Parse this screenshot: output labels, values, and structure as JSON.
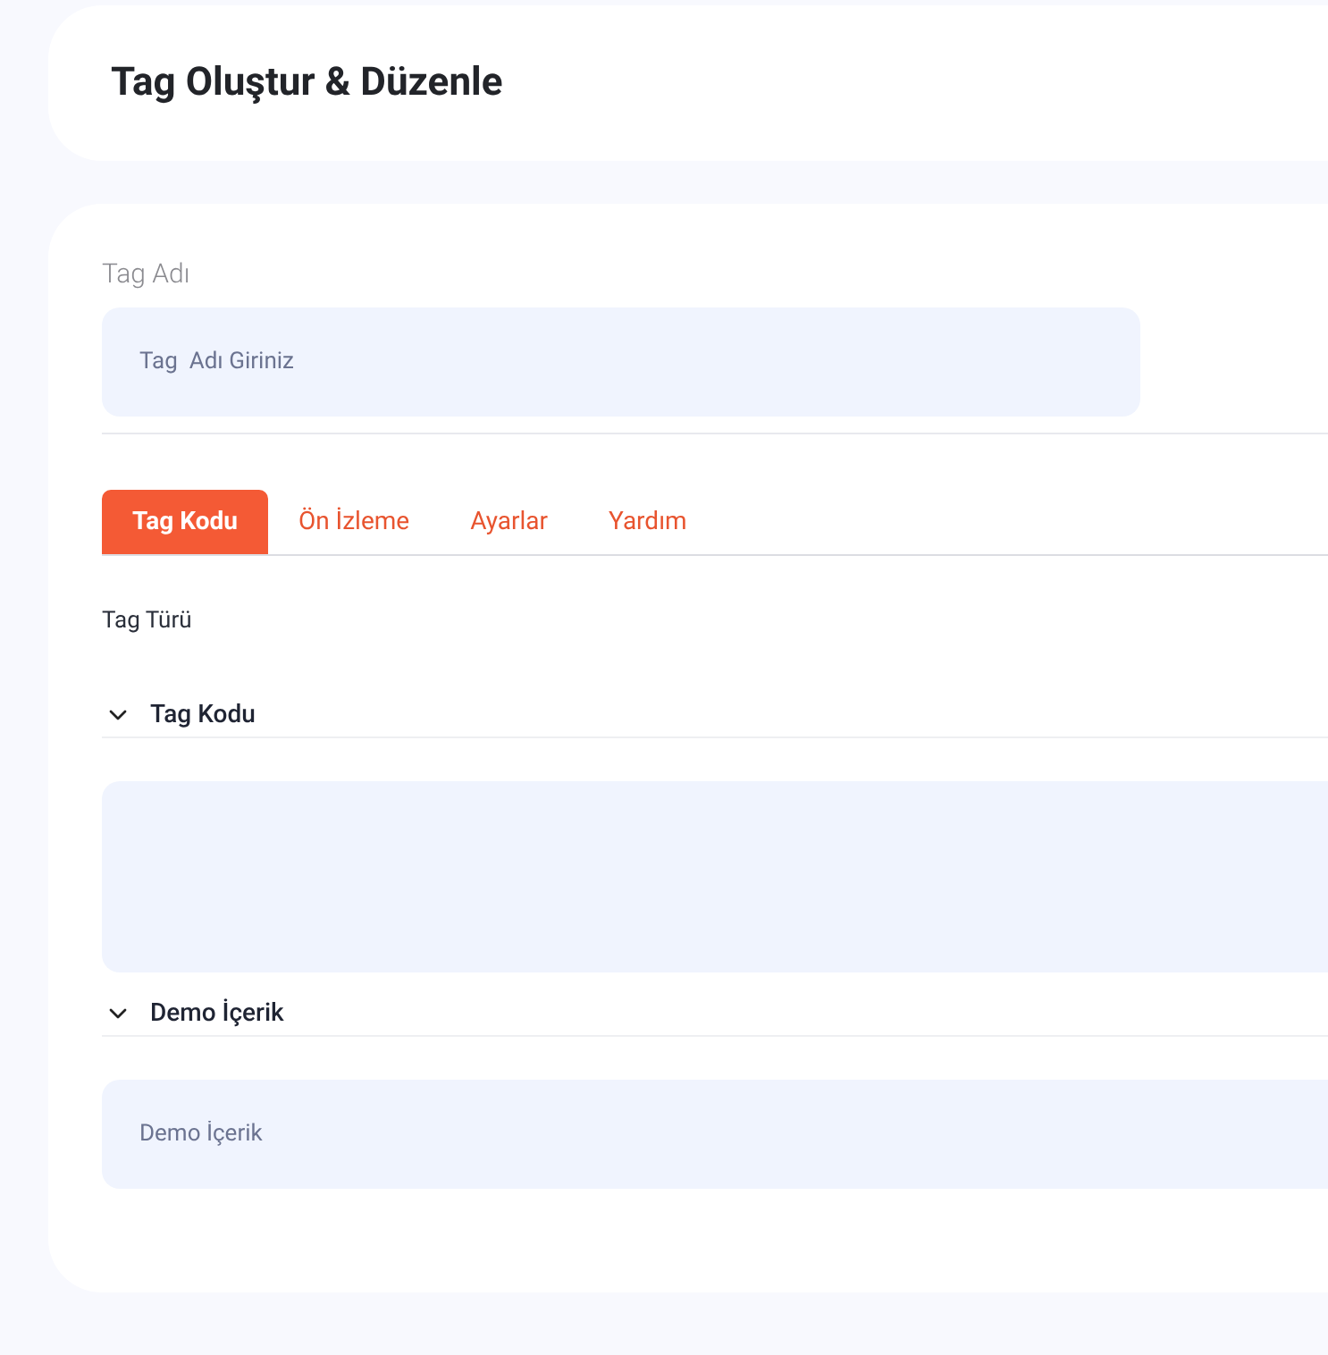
{
  "header": {
    "title": "Tag Oluştur & Düzenle"
  },
  "name_field": {
    "label": "Tag Adı",
    "placeholder": "Tag  Adı Giriniz"
  },
  "tabs": [
    {
      "label": "Tag Kodu",
      "selected": true
    },
    {
      "label": "Ön İzleme",
      "selected": false
    },
    {
      "label": "Ayarlar",
      "selected": false
    },
    {
      "label": "Yardım",
      "selected": false
    }
  ],
  "tag_type": {
    "label": "Tag Türü"
  },
  "sections": [
    {
      "title": "Tag Kodu",
      "expanded": true,
      "kind": "textarea"
    },
    {
      "title": "Demo İçerik",
      "expanded": true,
      "kind": "input",
      "placeholder": "Demo İçerik"
    }
  ]
}
